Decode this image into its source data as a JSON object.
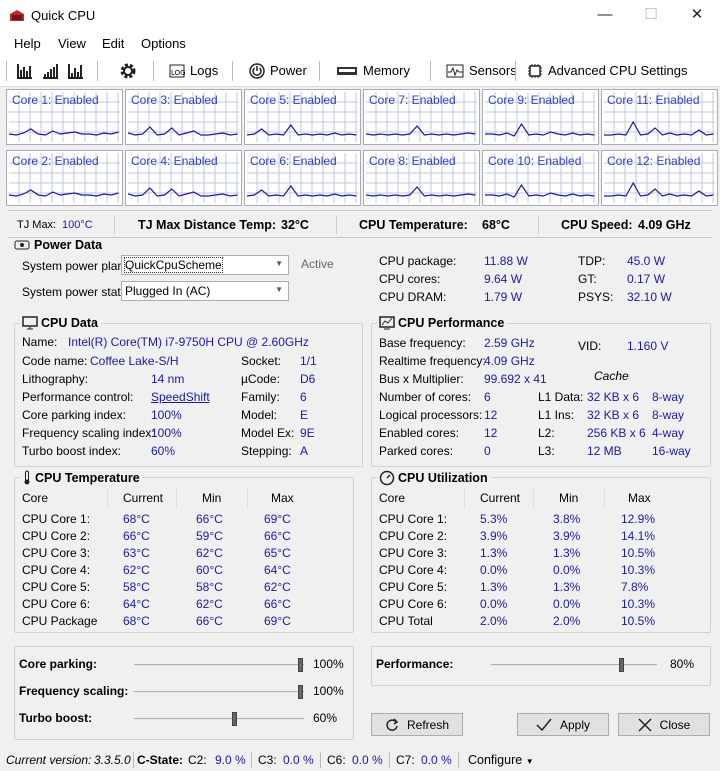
{
  "window": {
    "title": "Quick CPU",
    "minimize": "—",
    "maximize": "☐",
    "close": "✕"
  },
  "menu": [
    "Help",
    "View",
    "Edit",
    "Options"
  ],
  "toolbar": {
    "logs": "Logs",
    "power": "Power",
    "memory": "Memory",
    "sensors": "Sensors",
    "advanced": "Advanced CPU Settings"
  },
  "cores": [
    "Core 1: Enabled",
    "Core 3: Enabled",
    "Core 5: Enabled",
    "Core 7: Enabled",
    "Core 9: Enabled",
    "Core 11: Enabled",
    "Core 2: Enabled",
    "Core 4: Enabled",
    "Core 6: Enabled",
    "Core 8: Enabled",
    "Core 10: Enabled",
    "Core 12: Enabled"
  ],
  "info": {
    "tjmax_label": "TJ Max:",
    "tjmax_value": "100°C",
    "tjdist_label": "TJ Max Distance Temp:",
    "tjdist_value": "32°C",
    "cputemp_label": "CPU Temperature:",
    "cputemp_value": "68°C",
    "speed_label": "CPU Speed:",
    "speed_value": "4.09 GHz"
  },
  "power": {
    "title": "Power Data",
    "plan_label": "System power plan:",
    "plan_value": "QuickCpuScheme",
    "plan_status": "Active",
    "state_label": "System power state:",
    "state_value": "Plugged In (AC)",
    "rows": [
      {
        "l": "CPU package:",
        "v": "11.88 W",
        "l2": "TDP:",
        "v2": "45.0 W"
      },
      {
        "l": "CPU cores:",
        "v": "9.64 W",
        "l2": "GT:",
        "v2": "0.17 W"
      },
      {
        "l": "CPU DRAM:",
        "v": "1.79 W",
        "l2": "PSYS:",
        "v2": "32.10 W"
      }
    ]
  },
  "cpudata": {
    "title": "CPU Data",
    "name_label": "Name:",
    "name_value": "Intel(R) Core(TM) i7-9750H CPU @ 2.60GHz",
    "rows": [
      {
        "l": "Code name:",
        "v": "Coffee Lake-S/H",
        "l2": "Socket:",
        "v2": "1/1"
      },
      {
        "l": "Lithography:",
        "v": "14 nm",
        "l2": "µCode:",
        "v2": "D6"
      },
      {
        "l": "Performance control:",
        "v": "SpeedShift",
        "l2": "Family:",
        "v2": "6"
      },
      {
        "l": "Core parking index:",
        "v": "100%",
        "l2": "Model:",
        "v2": "E"
      },
      {
        "l": "Frequency scaling index:",
        "v": "100%",
        "l2": "Model Ex:",
        "v2": "9E"
      },
      {
        "l": "Turbo boost index:",
        "v": "60%",
        "l2": "Stepping:",
        "v2": "A"
      }
    ]
  },
  "perf": {
    "title": "CPU Performance",
    "base_label": "Base frequency:",
    "base_value": "2.59 GHz",
    "vid_label": "VID:",
    "vid_value": "1.160 V",
    "rt_label": "Realtime frequency:",
    "rt_value": "4.09 GHz",
    "bus_label": "Bus x Multiplier:",
    "bus_value": "99.692 x 41",
    "cache_label": "Cache",
    "rows": [
      {
        "l": "Number of cores:",
        "v": "6",
        "cl": "L1 Data:",
        "cv": "32 KB x 6",
        "cw": "8-way"
      },
      {
        "l": "Logical processors:",
        "v": "12",
        "cl": "L1 Ins:",
        "cv": "32 KB x 6",
        "cw": "8-way"
      },
      {
        "l": "Enabled cores:",
        "v": "12",
        "cl": "L2:",
        "cv": "256 KB x 6",
        "cw": "4-way"
      },
      {
        "l": "Parked cores:",
        "v": "0",
        "cl": "L3:",
        "cv": "12 MB",
        "cw": "16-way"
      }
    ]
  },
  "temp": {
    "title": "CPU Temperature",
    "headers": [
      "Core",
      "Current",
      "Min",
      "Max"
    ],
    "rows": [
      [
        "CPU Core 1:",
        "68°C",
        "66°C",
        "69°C"
      ],
      [
        "CPU Core 2:",
        "66°C",
        "59°C",
        "66°C"
      ],
      [
        "CPU Core 3:",
        "63°C",
        "62°C",
        "65°C"
      ],
      [
        "CPU Core 4:",
        "62°C",
        "60°C",
        "64°C"
      ],
      [
        "CPU Core 5:",
        "58°C",
        "58°C",
        "62°C"
      ],
      [
        "CPU Core 6:",
        "64°C",
        "62°C",
        "66°C"
      ],
      [
        "CPU Package",
        "68°C",
        "66°C",
        "69°C"
      ]
    ]
  },
  "util": {
    "title": "CPU Utilization",
    "headers": [
      "Core",
      "Current",
      "Min",
      "Max"
    ],
    "rows": [
      [
        "CPU Core 1:",
        "5.3%",
        "3.8%",
        "12.9%"
      ],
      [
        "CPU Core 2:",
        "3.9%",
        "3.9%",
        "14.1%"
      ],
      [
        "CPU Core 3:",
        "1.3%",
        "1.3%",
        "10.5%"
      ],
      [
        "CPU Core 4:",
        "0.0%",
        "0.0%",
        "10.3%"
      ],
      [
        "CPU Core 5:",
        "1.3%",
        "1.3%",
        "7.8%"
      ],
      [
        "CPU Core 6:",
        "0.0%",
        "0.0%",
        "10.3%"
      ],
      [
        "CPU Total",
        "2.0%",
        "2.0%",
        "10.5%"
      ]
    ]
  },
  "sliders": {
    "parking_label": "Core parking:",
    "parking_value": "100%",
    "parking_level": 1.0,
    "freq_label": "Frequency scaling:",
    "freq_value": "100%",
    "freq_level": 1.0,
    "turbo_label": "Turbo boost:",
    "turbo_value": "60%",
    "turbo_level": 0.6,
    "perf_label": "Performance:",
    "perf_value": "80%",
    "perf_level": 0.8
  },
  "buttons": {
    "refresh": "Refresh",
    "apply": "Apply",
    "close": "Close"
  },
  "status": {
    "version_label": "Current version:",
    "version_value": "3.3.5.0",
    "cstate_label": "C-State:",
    "c2_label": "C2:",
    "c2_value": "9.0 %",
    "c3_label": "C3:",
    "c3_value": "0.0 %",
    "c6_label": "C6:",
    "c6_value": "0.0 %",
    "c7_label": "C7:",
    "c7_value": "0.0 %",
    "configure": "Configure"
  }
}
